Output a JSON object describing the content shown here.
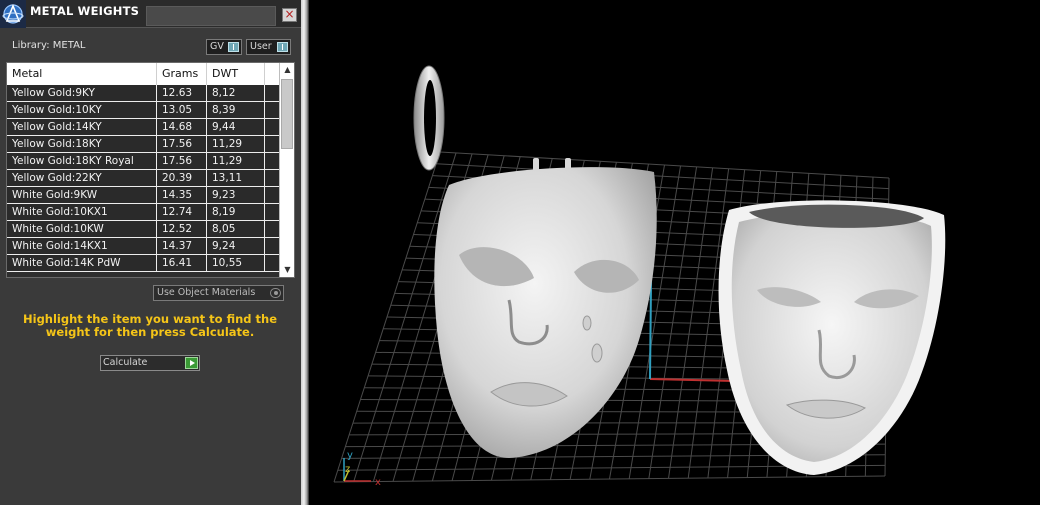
{
  "panel": {
    "title": "METAL WEIGHTS",
    "close_label": "×",
    "library_label": "Library: METAL",
    "toggles": {
      "gv": "GV",
      "user": "User"
    },
    "table": {
      "headers": {
        "metal": "Metal",
        "grams": "Grams",
        "dwt": "DWT"
      },
      "rows": [
        {
          "metal": "Yellow Gold:9KY",
          "grams": "12.63",
          "dwt": "8,12"
        },
        {
          "metal": "Yellow Gold:10KY",
          "grams": "13.05",
          "dwt": "8,39"
        },
        {
          "metal": "Yellow Gold:14KY",
          "grams": "14.68",
          "dwt": "9,44"
        },
        {
          "metal": "Yellow Gold:18KY",
          "grams": "17.56",
          "dwt": "11,29"
        },
        {
          "metal": "Yellow Gold:18KY Royal",
          "grams": "17.56",
          "dwt": "11,29"
        },
        {
          "metal": "Yellow Gold:22KY",
          "grams": "20.39",
          "dwt": "13,11"
        },
        {
          "metal": "White Gold:9KW",
          "grams": "14.35",
          "dwt": "9,23"
        },
        {
          "metal": "White Gold:10KX1",
          "grams": "12.74",
          "dwt": "8,19"
        },
        {
          "metal": "White Gold:10KW",
          "grams": "12.52",
          "dwt": "8,05"
        },
        {
          "metal": "White Gold:14KX1",
          "grams": "14.37",
          "dwt": "9,24"
        },
        {
          "metal": "White Gold:14K PdW",
          "grams": "16.41",
          "dwt": "10,55"
        }
      ]
    },
    "use_object_materials": "Use Object Materials",
    "hint": "Highlight the item you want to find the weight for then press Calculate.",
    "calculate_label": "Calculate"
  },
  "viewport": {
    "axes": {
      "y": "y",
      "z": "z",
      "x": "x"
    },
    "colors": {
      "panel_bg": "#3a3a3a",
      "hint": "#f5c518",
      "axis_x": "#c03030",
      "axis_y": "#30a0c0"
    }
  }
}
